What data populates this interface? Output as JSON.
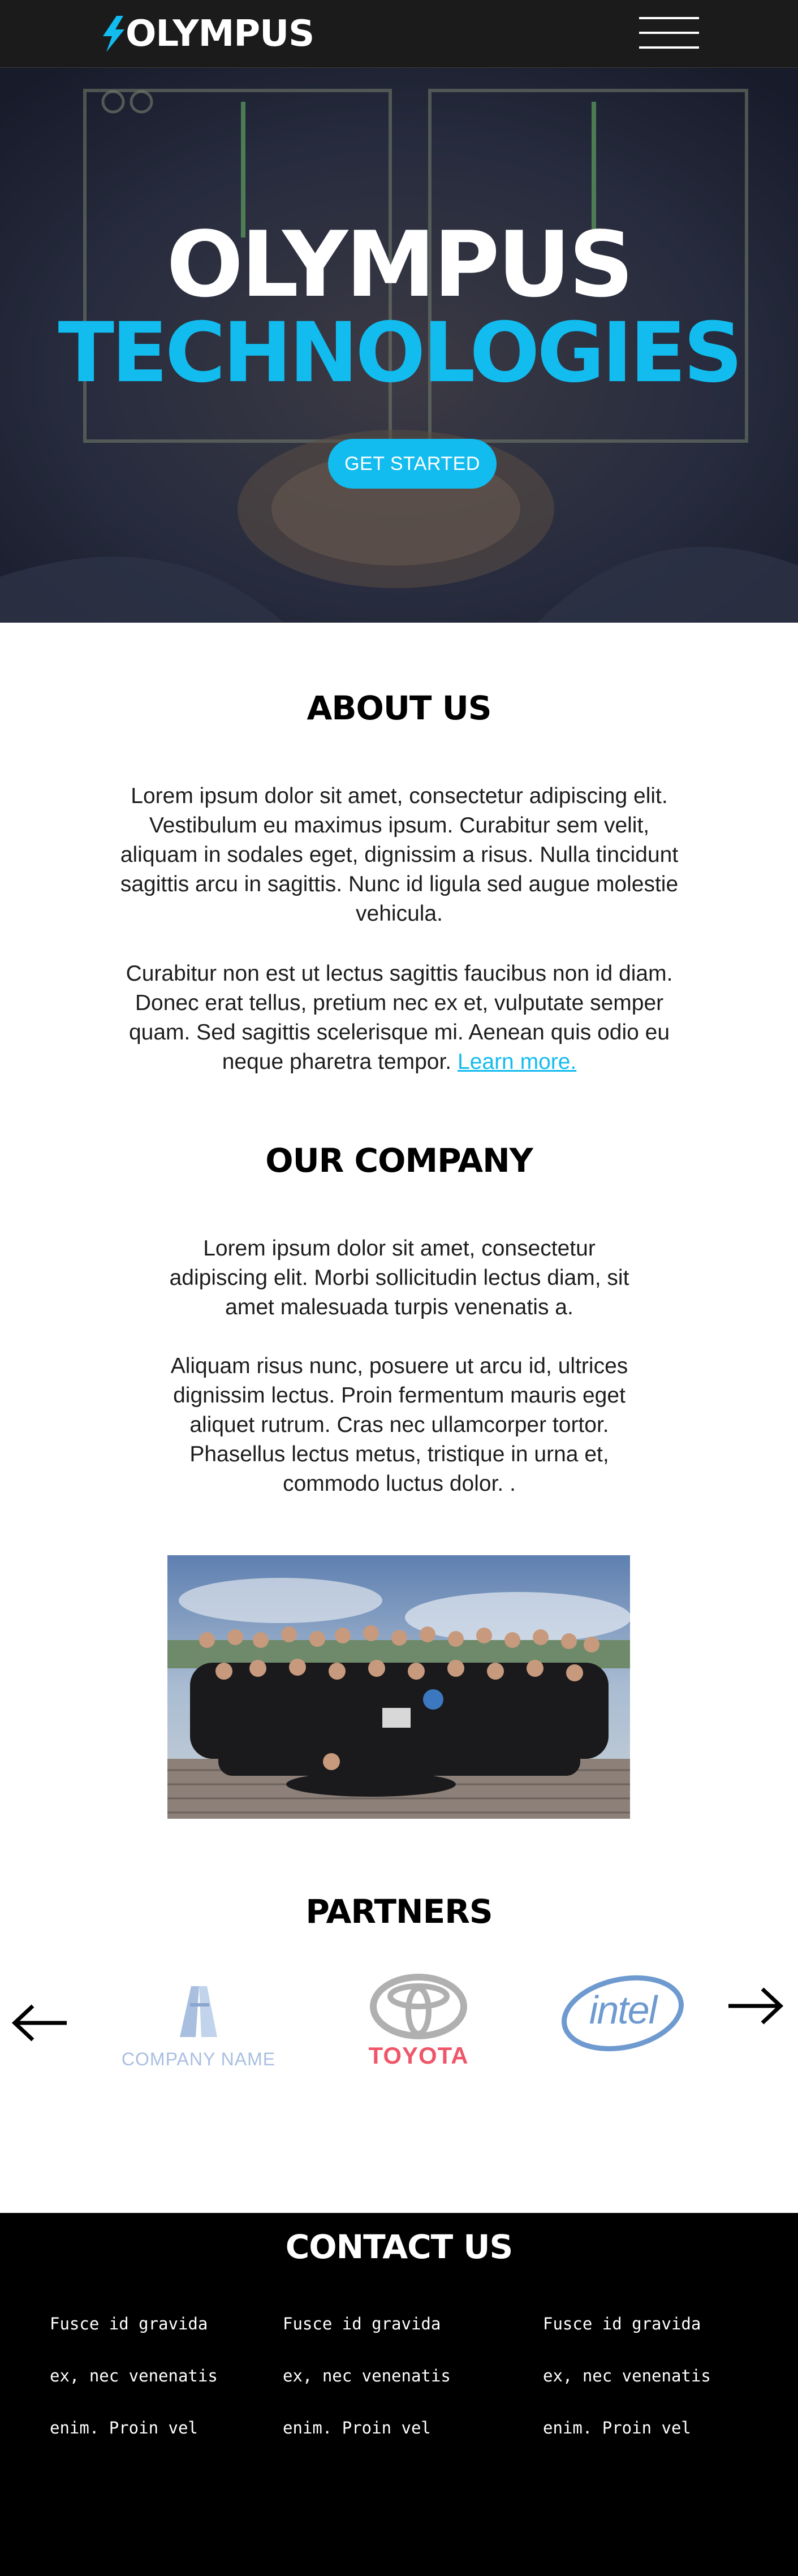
{
  "nav": {
    "logo_text": "OLYMPUS",
    "menu_icon": "hamburger-menu-icon"
  },
  "hero": {
    "title_line1": "OLYMPUS",
    "title_line2": "TECHNOLOGIES",
    "cta_label": "GET STARTED"
  },
  "about": {
    "title": "ABOUT US",
    "paragraph1": "Lorem ipsum dolor sit amet, consectetur adipiscing elit. Vestibulum eu maximus ipsum. Curabitur sem velit, aliquam in sodales eget, dignissim a risus. Nulla tincidunt sagittis arcu in sagittis. Nunc id ligula sed augue molestie vehicula.",
    "paragraph2": "Curabitur non est ut lectus sagittis faucibus non id diam. Donec erat tellus, pretium nec ex et, vulputate semper quam. Sed sagittis scelerisque mi. Aenean quis odio eu neque pharetra tempor.",
    "link_label": "Learn more."
  },
  "company": {
    "title": "OUR COMPANY",
    "paragraph1": "Lorem ipsum dolor sit amet, consectetur adipiscing elit. Morbi sollicitudin lectus diam, sit amet malesuada turpis venenatis a.",
    "paragraph2": "Aliquam risus nunc, posuere ut arcu id, ultrices dignissim lectus. Proin fermentum mauris eget aliquet rutrum. Cras nec ullamcorper tortor. Phasellus lectus metus, tristique in urna et, commodo luctus dolor. ."
  },
  "partners": {
    "title": "PARTNERS",
    "items": [
      {
        "name": "COMPANY NAME",
        "icon": "company-name-logo"
      },
      {
        "name": "TOYOTA",
        "icon": "toyota-logo"
      },
      {
        "name": "intel",
        "icon": "intel-logo"
      }
    ],
    "prev_icon": "arrow-left-icon",
    "next_icon": "arrow-right-icon"
  },
  "contact": {
    "title": "CONTACT US",
    "columns": [
      {
        "line1": "Fusce id gravida",
        "line2": "ex, nec venenatis",
        "line3": "enim. Proin vel"
      },
      {
        "line1": "Fusce id gravida",
        "line2": "ex, nec venenatis",
        "line3": "enim. Proin vel"
      },
      {
        "line1": "Fusce id gravida",
        "line2": "ex, nec venenatis",
        "line3": "enim. Proin vel"
      }
    ]
  },
  "colors": {
    "accent": "#12bcef",
    "nav_bg": "#1b1b1b",
    "footer_bg": "#000000",
    "toyota_red": "#f0566a",
    "intel_blue": "#6e9ad0"
  }
}
